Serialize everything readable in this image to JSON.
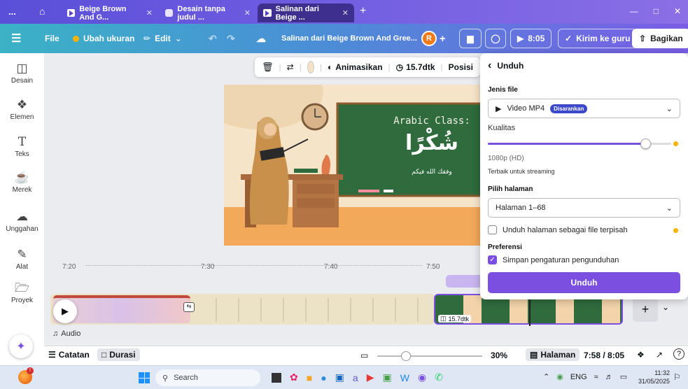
{
  "browser": {
    "tabs": [
      {
        "label": "Beige Brown And G...",
        "active": false
      },
      {
        "label": "Desain tanpa judul ...",
        "active": false
      },
      {
        "label": "Salinan dari Beige ...",
        "active": true
      }
    ],
    "new_tab": "+",
    "menu_dots": "...",
    "window_controls": [
      "—",
      "□",
      "✕"
    ]
  },
  "toolbar": {
    "menu_icon": "☰",
    "file": "File",
    "resize": "Ubah ukuran",
    "edit": "Edit",
    "doc_title": "Salinan dari Beige Brown And Gree...",
    "avatar": "R",
    "play_time": "8:05",
    "send_teacher": "Kirim ke guru",
    "share": "Bagikan"
  },
  "sidebar": {
    "items": [
      {
        "label": "Desain",
        "icon": "layout-icon"
      },
      {
        "label": "Elemen",
        "icon": "shapes-icon"
      },
      {
        "label": "Teks",
        "icon": "text-icon"
      },
      {
        "label": "Merek",
        "icon": "brand-icon"
      },
      {
        "label": "Unggahan",
        "icon": "upload-icon"
      },
      {
        "label": "Alat",
        "icon": "draw-icon"
      },
      {
        "label": "Proyek",
        "icon": "folder-icon"
      }
    ]
  },
  "context_bar": {
    "animate": "Animasikan",
    "duration": "15.7dtk",
    "position": "Posisi"
  },
  "slide": {
    "title": "Arabic Class:",
    "arabic_big": "شُكْرًا",
    "arabic_small": "وفقك الله فيكم"
  },
  "timeline": {
    "ruler": [
      "7:20",
      "7:30",
      "7:40",
      "7:50"
    ],
    "clip_duration": "15.7dtk",
    "audio_label": "Audio"
  },
  "status": {
    "notes": "Catatan",
    "duration": "Durasi",
    "zoom": "30%",
    "pages": "Halaman",
    "time": "7:58 / 8:05",
    "help": "?"
  },
  "taskbar": {
    "search": "Search",
    "lang": "ENG",
    "clock_time": "11:32",
    "clock_date": "31/05/2025"
  },
  "download_panel": {
    "back": "‹",
    "title": "Unduh",
    "file_type_label": "Jenis file",
    "file_type_value": "Video MP4",
    "recommended": "Disarankan",
    "quality_label": "Kualitas",
    "quality_value": "1080p (HD)",
    "quality_note": "Terbaik untuk streaming",
    "quality_level": 0.86,
    "pages_label": "Pilih halaman",
    "pages_value": "Halaman 1–68",
    "separate_files": "Unduh halaman sebagai file terpisah",
    "preferences_label": "Preferensi",
    "save_settings": "Simpan pengaturan pengunduhan",
    "save_settings_checked": true,
    "download_button": "Unduh"
  },
  "colors": {
    "accent": "#7b4fe0",
    "chalkboard": "#2f6b3d",
    "slide_bg": "#f6e4c9",
    "toolbar_start": "#3bb2c6",
    "toolbar_end": "#7a5de6"
  }
}
